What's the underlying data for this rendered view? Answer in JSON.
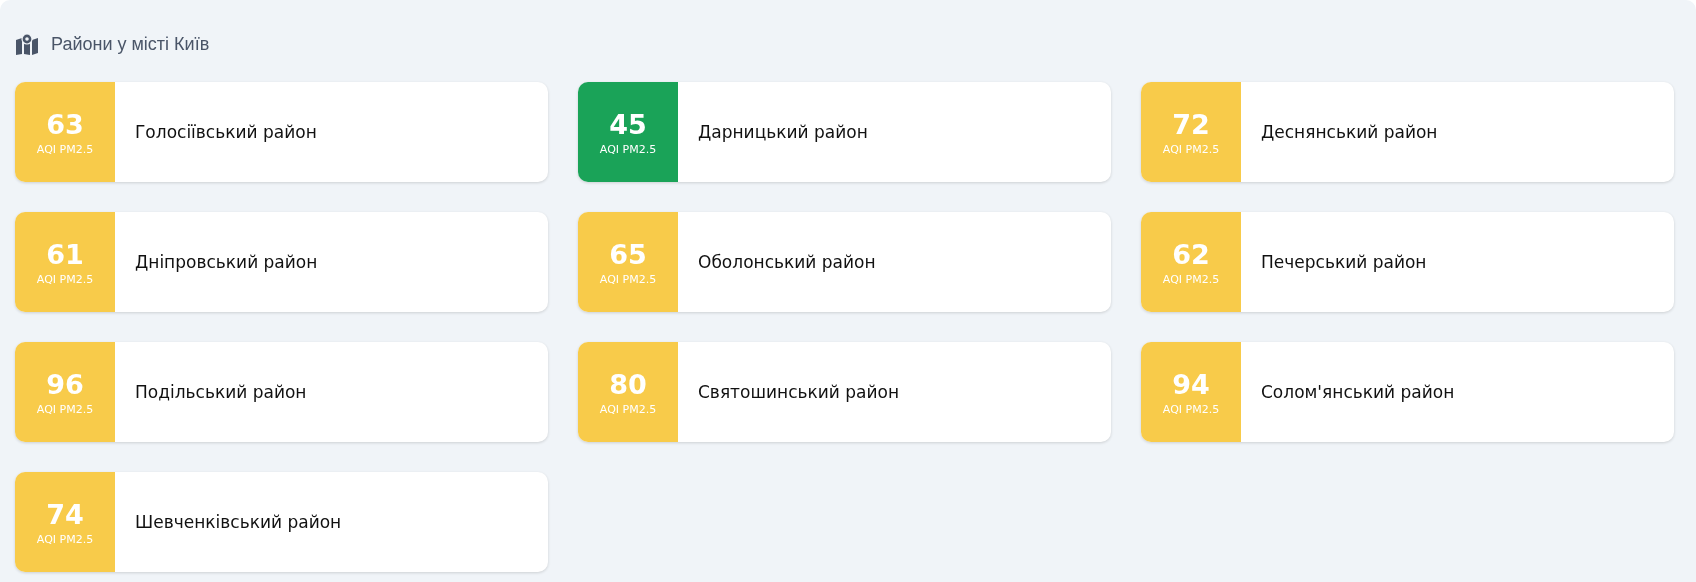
{
  "title": "Райони у місті Київ",
  "districts": [
    {
      "aqi": "63",
      "label": "AQI PM2.5",
      "name": "Голосіївський район",
      "color": "#f8cb4a"
    },
    {
      "aqi": "45",
      "label": "AQI PM2.5",
      "name": "Дарницький район",
      "color": "#1aa358"
    },
    {
      "aqi": "72",
      "label": "AQI PM2.5",
      "name": "Деснянський район",
      "color": "#f8cb4a"
    },
    {
      "aqi": "61",
      "label": "AQI PM2.5",
      "name": "Дніпровський район",
      "color": "#f8cb4a"
    },
    {
      "aqi": "65",
      "label": "AQI PM2.5",
      "name": "Оболонський район",
      "color": "#f8cb4a"
    },
    {
      "aqi": "62",
      "label": "AQI PM2.5",
      "name": "Печерський район",
      "color": "#f8cb4a"
    },
    {
      "aqi": "96",
      "label": "AQI PM2.5",
      "name": "Подільський район",
      "color": "#f8cb4a"
    },
    {
      "aqi": "80",
      "label": "AQI PM2.5",
      "name": "Святошинський район",
      "color": "#f8cb4a"
    },
    {
      "aqi": "94",
      "label": "AQI PM2.5",
      "name": "Солом'янський район",
      "color": "#f8cb4a"
    },
    {
      "aqi": "74",
      "label": "AQI PM2.5",
      "name": "Шевченківський район",
      "color": "#f8cb4a"
    }
  ]
}
